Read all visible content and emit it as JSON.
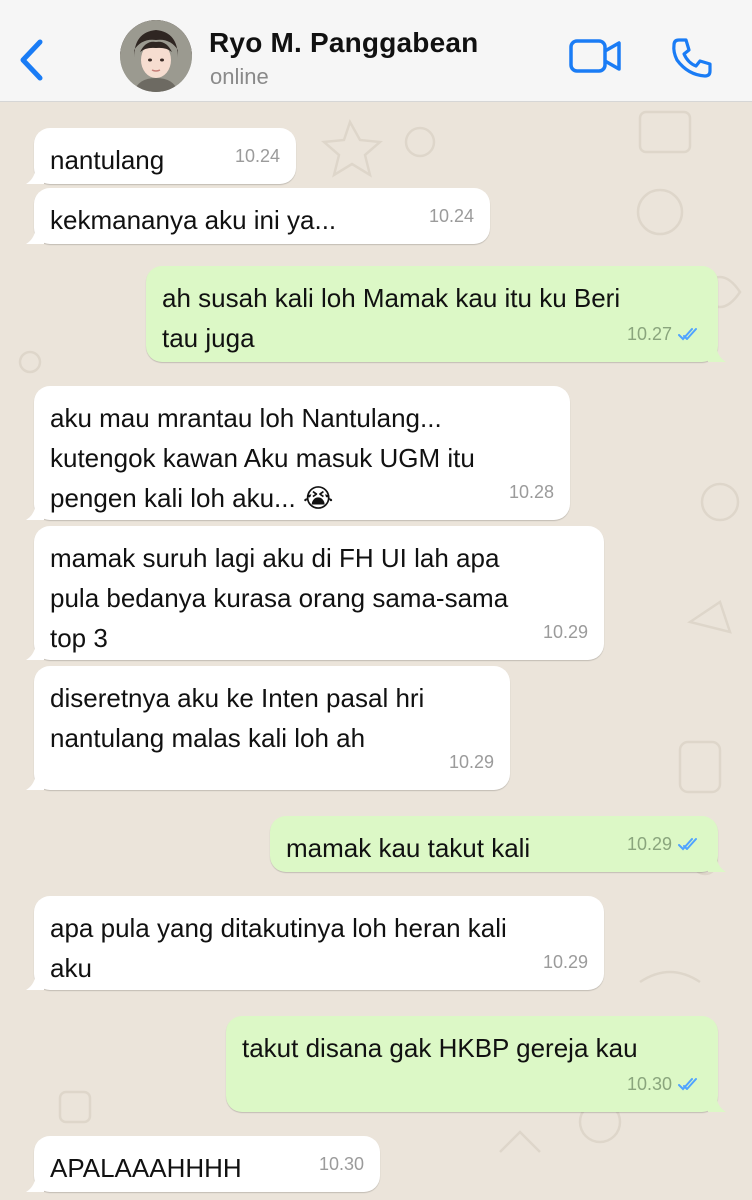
{
  "header": {
    "contact_name": "Ryo M. Panggabean",
    "status": "online",
    "icons": {
      "back": "chevron-left-icon",
      "video": "video-camera-icon",
      "call": "phone-icon"
    },
    "accent_color": "#1a7cf5"
  },
  "colors": {
    "incoming_bubble": "#ffffff",
    "outgoing_bubble": "#dcf8c6",
    "read_ticks": "#4fa3ff",
    "wallpaper": "#ebe4da"
  },
  "messages": [
    {
      "direction": "in",
      "text": "nantulang",
      "time": "10.24"
    },
    {
      "direction": "in",
      "text": "kekmananya aku ini ya...",
      "time": "10.24"
    },
    {
      "direction": "out",
      "text": "ah susah kali loh Mamak kau itu ku Beri tau juga",
      "time": "10.27",
      "status": "read"
    },
    {
      "direction": "in",
      "text": "aku mau mrantau loh Nantulang... kutengok kawan Aku masuk UGM itu pengen kali loh aku... 😭",
      "time": "10.28"
    },
    {
      "direction": "in",
      "text": "mamak suruh lagi aku di FH UI lah apa pula bedanya kurasa orang sama-sama top 3",
      "time": "10.29"
    },
    {
      "direction": "in",
      "text": "diseretnya aku ke Inten pasal hri nantulang malas kali loh ah",
      "time": "10.29"
    },
    {
      "direction": "out",
      "text": "mamak kau takut kali",
      "time": "10.29",
      "status": "read"
    },
    {
      "direction": "in",
      "text": "apa pula yang ditakutinya loh heran kali aku",
      "time": "10.29"
    },
    {
      "direction": "out",
      "text": "takut disana gak HKBP gereja kau",
      "time": "10.30",
      "status": "read"
    },
    {
      "direction": "in",
      "text": "APALAAAHHHH",
      "time": "10.30"
    }
  ]
}
